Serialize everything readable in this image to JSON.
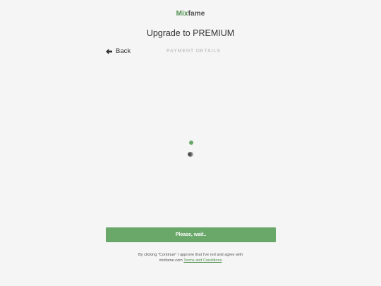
{
  "brand": {
    "logo_part1": "Mix",
    "logo_part2": "fame",
    "accent_color": "#6aa86a"
  },
  "header": {
    "title": "Upgrade to PREMIUM"
  },
  "nav": {
    "back_label": "Back",
    "back_icon": "arrow-left-icon",
    "step_label": "PAYMENT DETAILS"
  },
  "loader": {
    "dot_color": "#6aa86a"
  },
  "cta": {
    "label": "Please, wait.."
  },
  "legal": {
    "line1": "By clicking \"Continue\" I approve that I've red and agree with",
    "line2_prefix": "mixfame.com",
    "terms_link": "Terms and Conditions"
  }
}
